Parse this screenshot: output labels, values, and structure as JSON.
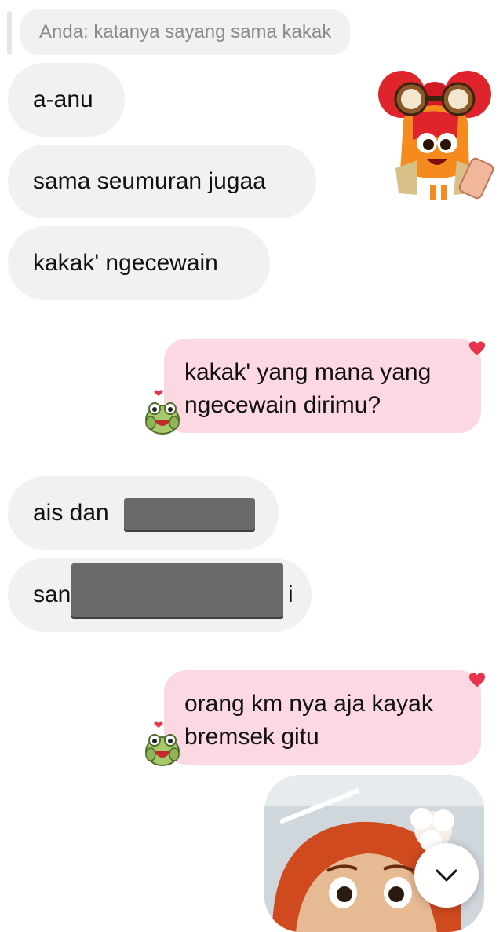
{
  "reply": {
    "quote": "Anda: katanya sayang sama kakak"
  },
  "messages_in_1": [
    "a-anu",
    "sama seumuran jugaa",
    "kakak' ngecewain"
  ],
  "outgoing_1": {
    "line1": "kakak' yang mana yang",
    "line2": "ngecewain dirimu?"
  },
  "messages_in_2": {
    "first_prefix": "ais dan",
    "second_prefix": "san",
    "second_suffix": "i"
  },
  "outgoing_2": {
    "line1": "orang km nya aja kayak",
    "line2": "bremsek gitu"
  },
  "icons": {
    "heart": "heart-icon",
    "frog": "frog-sticker-icon",
    "sticker": "orange-character-sticker",
    "scroll": "chevron-down-icon"
  },
  "colors": {
    "incoming_bubble": "#f1f1f1",
    "outgoing_bubble": "#fcd8e2",
    "heart": "#e8334f",
    "redaction": "#6a6a6a"
  }
}
